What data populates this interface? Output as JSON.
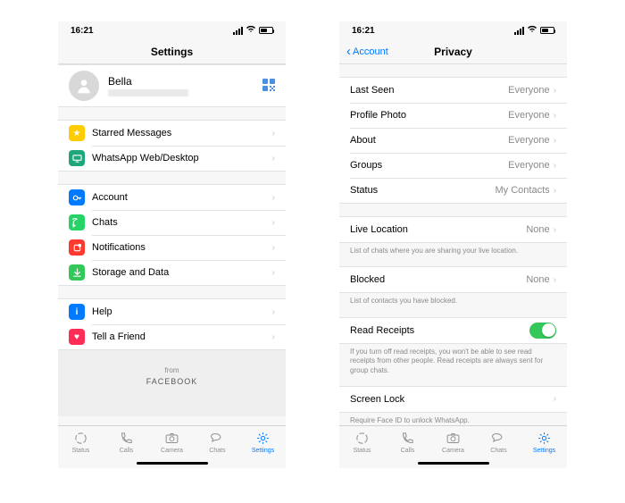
{
  "status": {
    "time": "16:21"
  },
  "left": {
    "title": "Settings",
    "profile": {
      "name": "Bella"
    },
    "group1": {
      "starred": "Starred Messages",
      "web": "WhatsApp Web/Desktop"
    },
    "group2": {
      "account": "Account",
      "chats": "Chats",
      "notif": "Notifications",
      "storage": "Storage and Data"
    },
    "group3": {
      "help": "Help",
      "tell": "Tell a Friend"
    },
    "facebook": {
      "from": "from",
      "brand": "FACEBOOK"
    }
  },
  "right": {
    "back": "Account",
    "title": "Privacy",
    "privacy": {
      "last_seen": {
        "label": "Last Seen",
        "value": "Everyone"
      },
      "photo": {
        "label": "Profile Photo",
        "value": "Everyone"
      },
      "about": {
        "label": "About",
        "value": "Everyone"
      },
      "groups": {
        "label": "Groups",
        "value": "Everyone"
      },
      "status": {
        "label": "Status",
        "value": "My Contacts"
      }
    },
    "live": {
      "label": "Live Location",
      "value": "None"
    },
    "live_footer": "List of chats where you are sharing your live location.",
    "blocked": {
      "label": "Blocked",
      "value": "None"
    },
    "blocked_footer": "List of contacts you have blocked.",
    "read": {
      "label": "Read Receipts"
    },
    "read_footer": "If you turn off read receipts, you won't be able to see read receipts from other people. Read receipts are always sent for group chats.",
    "screen": {
      "label": "Screen Lock"
    },
    "screen_footer": "Require Face ID to unlock WhatsApp."
  },
  "tabs": {
    "status": "Status",
    "calls": "Calls",
    "camera": "Camera",
    "chats": "Chats",
    "settings": "Settings"
  }
}
